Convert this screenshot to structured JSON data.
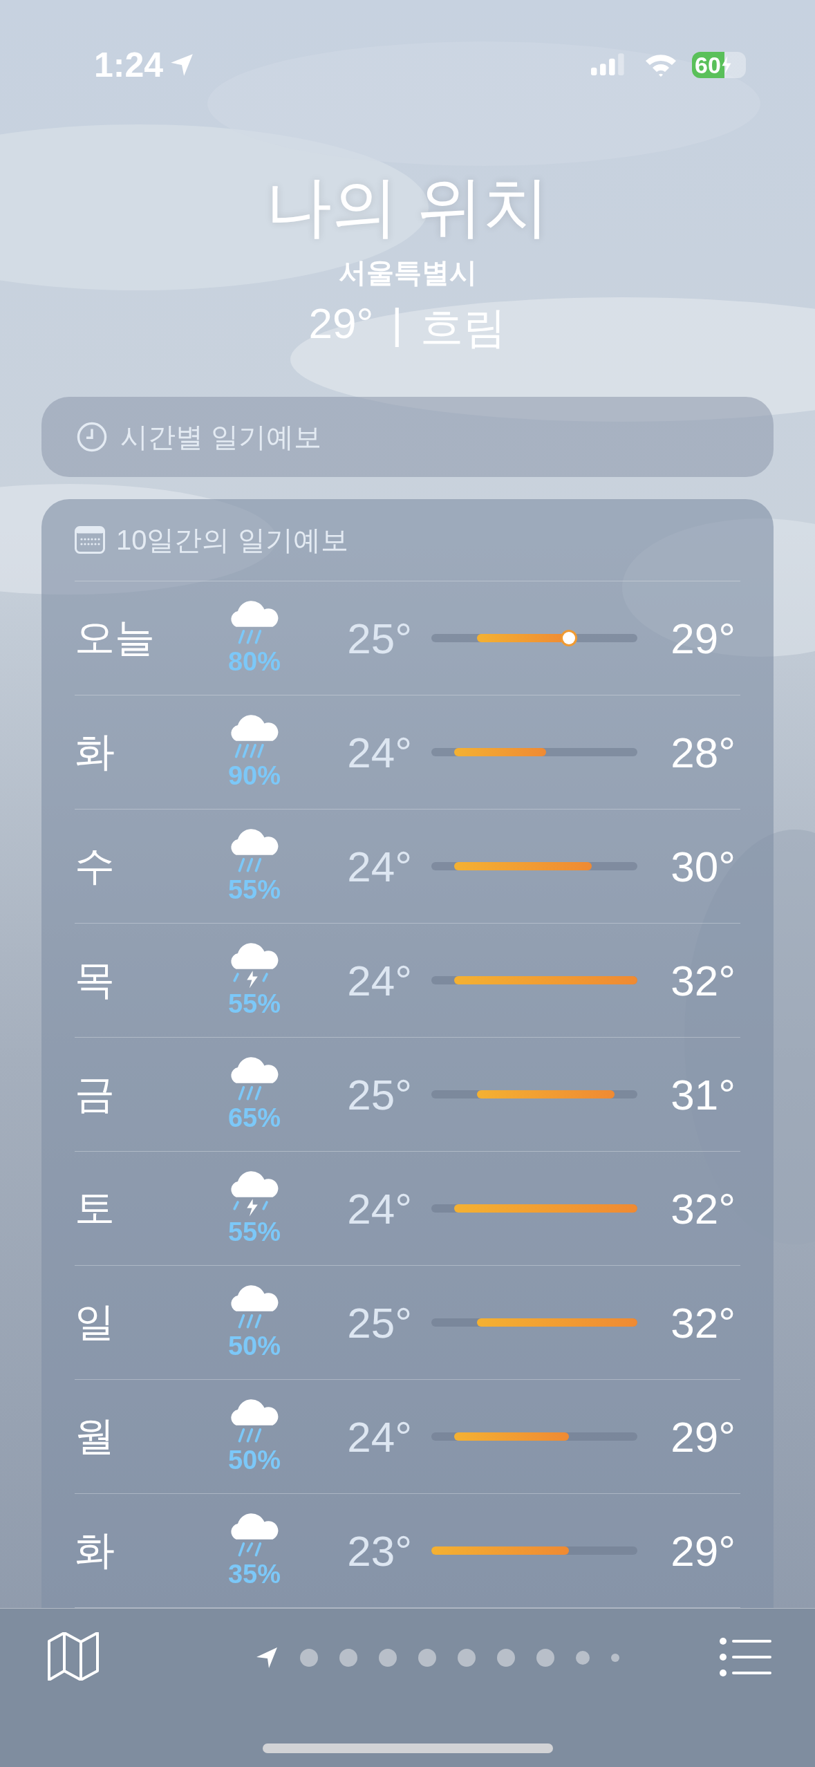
{
  "status_bar": {
    "time": "1:24",
    "battery": "60"
  },
  "header": {
    "title": "나의 위치",
    "city": "서울특별시",
    "temperature": "29°",
    "divider": "|",
    "condition": "흐림"
  },
  "hourly_card": {
    "title": "시간별 일기예보"
  },
  "daily_card": {
    "title": "10일간의 일기예보",
    "days": [
      {
        "day": "오늘",
        "kind": "rain",
        "chance": "80%",
        "low": "25°",
        "high": "29°",
        "current_marker": true
      },
      {
        "day": "화",
        "kind": "heavy-rain",
        "chance": "90%",
        "low": "24°",
        "high": "28°",
        "current_marker": false
      },
      {
        "day": "수",
        "kind": "rain",
        "chance": "55%",
        "low": "24°",
        "high": "30°",
        "current_marker": false
      },
      {
        "day": "목",
        "kind": "thunder",
        "chance": "55%",
        "low": "24°",
        "high": "32°",
        "current_marker": false
      },
      {
        "day": "금",
        "kind": "rain",
        "chance": "65%",
        "low": "25°",
        "high": "31°",
        "current_marker": false
      },
      {
        "day": "토",
        "kind": "thunder",
        "chance": "55%",
        "low": "24°",
        "high": "32°",
        "current_marker": false
      },
      {
        "day": "일",
        "kind": "rain",
        "chance": "50%",
        "low": "25°",
        "high": "32°",
        "current_marker": false
      },
      {
        "day": "월",
        "kind": "rain",
        "chance": "50%",
        "low": "24°",
        "high": "29°",
        "current_marker": false
      },
      {
        "day": "화",
        "kind": "drizzle",
        "chance": "35%",
        "low": "23°",
        "high": "29°",
        "current_marker": false
      }
    ]
  },
  "pages": [
    {
      "kind": "location",
      "selected": true
    },
    {
      "kind": "dot",
      "selected": false
    },
    {
      "kind": "dot",
      "selected": false
    },
    {
      "kind": "dot",
      "selected": false
    },
    {
      "kind": "dot",
      "selected": false
    },
    {
      "kind": "dot",
      "selected": false
    },
    {
      "kind": "dot",
      "selected": false
    },
    {
      "kind": "dot",
      "selected": false
    },
    {
      "kind": "small-dot",
      "selected": false
    },
    {
      "kind": "tiny-dot",
      "selected": false
    }
  ]
}
